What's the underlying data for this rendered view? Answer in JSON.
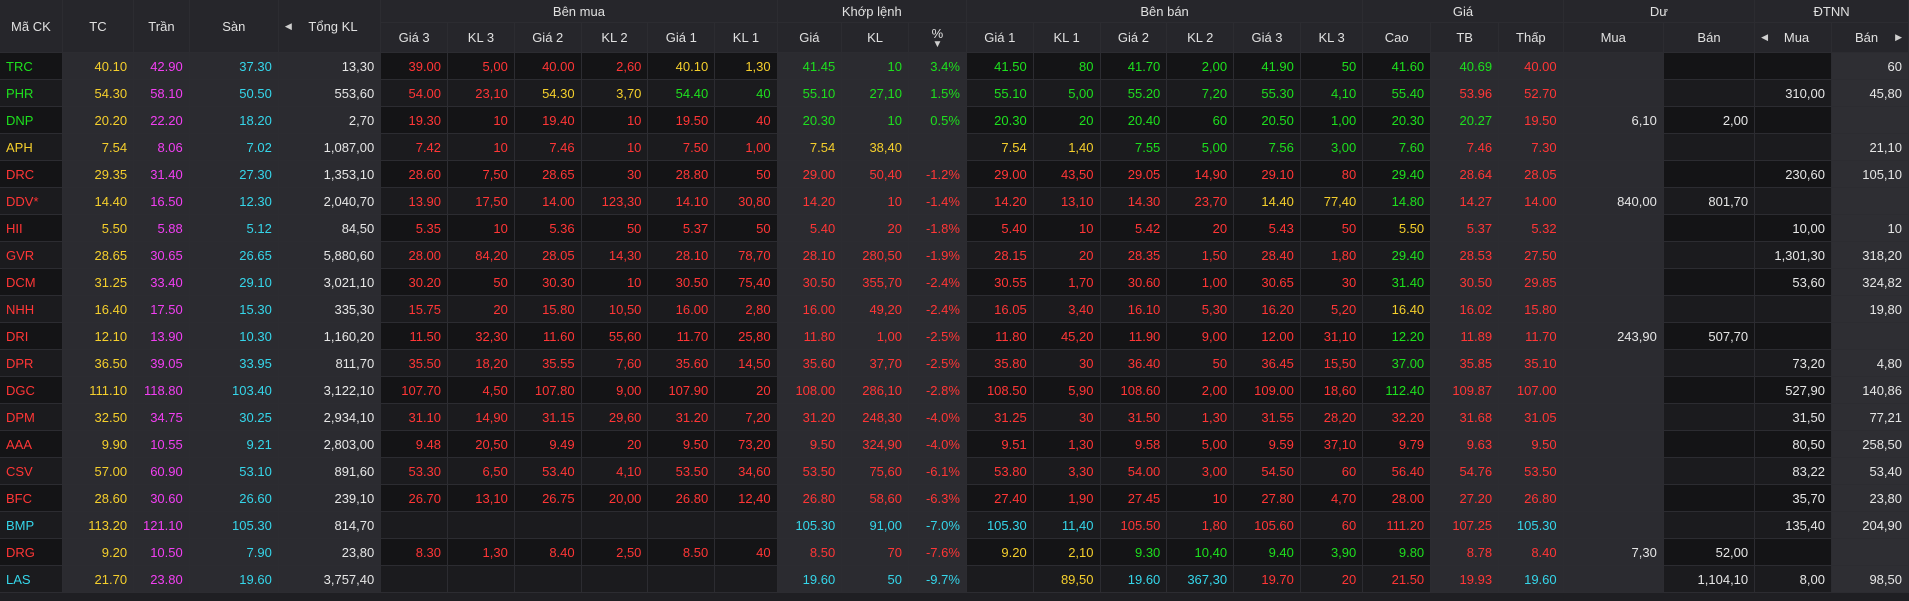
{
  "colors": {
    "up": "#1ee01e",
    "down": "#ff3636",
    "ref": "#f5cf2c",
    "ceiling": "#f23ff2",
    "floor": "#35d6ea"
  },
  "headers": {
    "symbol": "Mã CK",
    "ref": "TC",
    "ceil": "Trần",
    "floor": "Sàn",
    "total_vol": "Tổng KL",
    "bid_group": "Bên mua",
    "match_group": "Khớp lệnh",
    "ask_group": "Bên bán",
    "price_group": "Giá",
    "remain_group": "Dư",
    "foreign_group": "ĐTNN",
    "bid": [
      "Giá 3",
      "KL 3",
      "Giá 2",
      "KL 2",
      "Giá 1",
      "KL 1"
    ],
    "match": [
      "Giá",
      "KL",
      "%"
    ],
    "ask": [
      "Giá 1",
      "KL 1",
      "Giá 2",
      "KL 2",
      "Giá 3",
      "KL 3"
    ],
    "price": [
      "Cao",
      "TB",
      "Thấp"
    ],
    "remain": [
      "Mua",
      "Bán"
    ],
    "foreign": [
      "Mua",
      "Bán"
    ],
    "left_arrow": "◀",
    "right_arrow": "▶",
    "sort_arrow": "▼"
  },
  "rows": [
    {
      "s": "TRC",
      "c": "up",
      "v": [
        "40.10",
        "42.90",
        "37.30",
        "13,30",
        "39.00",
        "5,00",
        "40.00",
        "2,60",
        "40.10",
        "1,30",
        "41.45",
        "10",
        "3.4%",
        "41.50",
        "80",
        "41.70",
        "2,00",
        "41.90",
        "50",
        "41.60",
        "40.69",
        "40.00",
        "",
        "",
        "",
        "60"
      ],
      "k": [
        "ref",
        "ceil",
        "floor",
        "neu",
        "down",
        "down",
        "down",
        "down",
        "ref",
        "ref",
        "up",
        "up",
        "up",
        "up",
        "up",
        "up",
        "up",
        "up",
        "up",
        "up",
        "up",
        "down",
        "neu",
        "neu",
        "neu",
        "neu"
      ]
    },
    {
      "s": "PHR",
      "c": "up",
      "v": [
        "54.30",
        "58.10",
        "50.50",
        "553,60",
        "54.00",
        "23,10",
        "54.30",
        "3,70",
        "54.40",
        "40",
        "55.10",
        "27,10",
        "1.5%",
        "55.10",
        "5,00",
        "55.20",
        "7,20",
        "55.30",
        "4,10",
        "55.40",
        "53.96",
        "52.70",
        "",
        "",
        "310,00",
        "45,80"
      ],
      "k": [
        "ref",
        "ceil",
        "floor",
        "neu",
        "down",
        "down",
        "ref",
        "ref",
        "up",
        "up",
        "up",
        "up",
        "up",
        "up",
        "up",
        "up",
        "up",
        "up",
        "up",
        "up",
        "down",
        "down",
        "neu",
        "neu",
        "neu",
        "neu"
      ]
    },
    {
      "s": "DNP",
      "c": "up",
      "v": [
        "20.20",
        "22.20",
        "18.20",
        "2,70",
        "19.30",
        "10",
        "19.40",
        "10",
        "19.50",
        "40",
        "20.30",
        "10",
        "0.5%",
        "20.30",
        "20",
        "20.40",
        "60",
        "20.50",
        "1,00",
        "20.30",
        "20.27",
        "19.50",
        "6,10",
        "2,00",
        "",
        ""
      ],
      "k": [
        "ref",
        "ceil",
        "floor",
        "neu",
        "down",
        "down",
        "down",
        "down",
        "down",
        "down",
        "up",
        "up",
        "up",
        "up",
        "up",
        "up",
        "up",
        "up",
        "up",
        "up",
        "up",
        "down",
        "neu",
        "neu",
        "neu",
        "neu"
      ]
    },
    {
      "s": "APH",
      "c": "ref",
      "v": [
        "7.54",
        "8.06",
        "7.02",
        "1,087,00",
        "7.42",
        "10",
        "7.46",
        "10",
        "7.50",
        "1,00",
        "7.54",
        "38,40",
        "",
        "7.54",
        "1,40",
        "7.55",
        "5,00",
        "7.56",
        "3,00",
        "7.60",
        "7.46",
        "7.30",
        "",
        "",
        "",
        "21,10"
      ],
      "k": [
        "ref",
        "ceil",
        "floor",
        "neu",
        "down",
        "down",
        "down",
        "down",
        "down",
        "down",
        "ref",
        "ref",
        "ref",
        "ref",
        "ref",
        "up",
        "up",
        "up",
        "up",
        "up",
        "down",
        "down",
        "neu",
        "neu",
        "neu",
        "neu"
      ]
    },
    {
      "s": "DRC",
      "c": "down",
      "v": [
        "29.35",
        "31.40",
        "27.30",
        "1,353,10",
        "28.60",
        "7,50",
        "28.65",
        "30",
        "28.80",
        "50",
        "29.00",
        "50,40",
        "-1.2%",
        "29.00",
        "43,50",
        "29.05",
        "14,90",
        "29.10",
        "80",
        "29.40",
        "28.64",
        "28.05",
        "",
        "",
        "230,60",
        "105,10"
      ],
      "k": [
        "ref",
        "ceil",
        "floor",
        "neu",
        "down",
        "down",
        "down",
        "down",
        "down",
        "down",
        "down",
        "down",
        "down",
        "down",
        "down",
        "down",
        "down",
        "down",
        "down",
        "up",
        "down",
        "down",
        "neu",
        "neu",
        "neu",
        "neu"
      ]
    },
    {
      "s": "DDV*",
      "c": "down",
      "v": [
        "14.40",
        "16.50",
        "12.30",
        "2,040,70",
        "13.90",
        "17,50",
        "14.00",
        "123,30",
        "14.10",
        "30,80",
        "14.20",
        "10",
        "-1.4%",
        "14.20",
        "13,10",
        "14.30",
        "23,70",
        "14.40",
        "77,40",
        "14.80",
        "14.27",
        "14.00",
        "840,00",
        "801,70",
        "",
        ""
      ],
      "k": [
        "ref",
        "ceil",
        "floor",
        "neu",
        "down",
        "down",
        "down",
        "down",
        "down",
        "down",
        "down",
        "down",
        "down",
        "down",
        "down",
        "down",
        "down",
        "ref",
        "ref",
        "up",
        "down",
        "down",
        "neu",
        "neu",
        "neu",
        "neu"
      ]
    },
    {
      "s": "HII",
      "c": "down",
      "v": [
        "5.50",
        "5.88",
        "5.12",
        "84,50",
        "5.35",
        "10",
        "5.36",
        "50",
        "5.37",
        "50",
        "5.40",
        "20",
        "-1.8%",
        "5.40",
        "10",
        "5.42",
        "20",
        "5.43",
        "50",
        "5.50",
        "5.37",
        "5.32",
        "",
        "",
        "10,00",
        "10"
      ],
      "k": [
        "ref",
        "ceil",
        "floor",
        "neu",
        "down",
        "down",
        "down",
        "down",
        "down",
        "down",
        "down",
        "down",
        "down",
        "down",
        "down",
        "down",
        "down",
        "down",
        "down",
        "ref",
        "down",
        "down",
        "neu",
        "neu",
        "neu",
        "neu"
      ]
    },
    {
      "s": "GVR",
      "c": "down",
      "v": [
        "28.65",
        "30.65",
        "26.65",
        "5,880,60",
        "28.00",
        "84,20",
        "28.05",
        "14,30",
        "28.10",
        "78,70",
        "28.10",
        "280,50",
        "-1.9%",
        "28.15",
        "20",
        "28.35",
        "1,50",
        "28.40",
        "1,80",
        "29.40",
        "28.53",
        "27.50",
        "",
        "",
        "1,301,30",
        "318,20"
      ],
      "k": [
        "ref",
        "ceil",
        "floor",
        "neu",
        "down",
        "down",
        "down",
        "down",
        "down",
        "down",
        "down",
        "down",
        "down",
        "down",
        "down",
        "down",
        "down",
        "down",
        "down",
        "up",
        "down",
        "down",
        "neu",
        "neu",
        "neu",
        "neu"
      ]
    },
    {
      "s": "DCM",
      "c": "down",
      "v": [
        "31.25",
        "33.40",
        "29.10",
        "3,021,10",
        "30.20",
        "50",
        "30.30",
        "10",
        "30.50",
        "75,40",
        "30.50",
        "355,70",
        "-2.4%",
        "30.55",
        "1,70",
        "30.60",
        "1,00",
        "30.65",
        "30",
        "31.40",
        "30.50",
        "29.85",
        "",
        "",
        "53,60",
        "324,82"
      ],
      "k": [
        "ref",
        "ceil",
        "floor",
        "neu",
        "down",
        "down",
        "down",
        "down",
        "down",
        "down",
        "down",
        "down",
        "down",
        "down",
        "down",
        "down",
        "down",
        "down",
        "down",
        "up",
        "down",
        "down",
        "neu",
        "neu",
        "neu",
        "neu"
      ]
    },
    {
      "s": "NHH",
      "c": "down",
      "v": [
        "16.40",
        "17.50",
        "15.30",
        "335,30",
        "15.75",
        "20",
        "15.80",
        "10,50",
        "16.00",
        "2,80",
        "16.00",
        "49,20",
        "-2.4%",
        "16.05",
        "3,40",
        "16.10",
        "5,30",
        "16.20",
        "5,20",
        "16.40",
        "16.02",
        "15.80",
        "",
        "",
        "",
        "19,80"
      ],
      "k": [
        "ref",
        "ceil",
        "floor",
        "neu",
        "down",
        "down",
        "down",
        "down",
        "down",
        "down",
        "down",
        "down",
        "down",
        "down",
        "down",
        "down",
        "down",
        "down",
        "down",
        "ref",
        "down",
        "down",
        "neu",
        "neu",
        "neu",
        "neu"
      ]
    },
    {
      "s": "DRI",
      "c": "down",
      "v": [
        "12.10",
        "13.90",
        "10.30",
        "1,160,20",
        "11.50",
        "32,30",
        "11.60",
        "55,60",
        "11.70",
        "25,80",
        "11.80",
        "1,00",
        "-2.5%",
        "11.80",
        "45,20",
        "11.90",
        "9,00",
        "12.00",
        "31,10",
        "12.20",
        "11.89",
        "11.70",
        "243,90",
        "507,70",
        "",
        ""
      ],
      "k": [
        "ref",
        "ceil",
        "floor",
        "neu",
        "down",
        "down",
        "down",
        "down",
        "down",
        "down",
        "down",
        "down",
        "down",
        "down",
        "down",
        "down",
        "down",
        "down",
        "down",
        "up",
        "down",
        "down",
        "neu",
        "neu",
        "neu",
        "neu"
      ]
    },
    {
      "s": "DPR",
      "c": "down",
      "v": [
        "36.50",
        "39.05",
        "33.95",
        "811,70",
        "35.50",
        "18,20",
        "35.55",
        "7,60",
        "35.60",
        "14,50",
        "35.60",
        "37,70",
        "-2.5%",
        "35.80",
        "30",
        "36.40",
        "50",
        "36.45",
        "15,50",
        "37.00",
        "35.85",
        "35.10",
        "",
        "",
        "73,20",
        "4,80"
      ],
      "k": [
        "ref",
        "ceil",
        "floor",
        "neu",
        "down",
        "down",
        "down",
        "down",
        "down",
        "down",
        "down",
        "down",
        "down",
        "down",
        "down",
        "down",
        "down",
        "down",
        "down",
        "up",
        "down",
        "down",
        "neu",
        "neu",
        "neu",
        "neu"
      ]
    },
    {
      "s": "DGC",
      "c": "down",
      "v": [
        "111.10",
        "118.80",
        "103.40",
        "3,122,10",
        "107.70",
        "4,50",
        "107.80",
        "9,00",
        "107.90",
        "20",
        "108.00",
        "286,10",
        "-2.8%",
        "108.50",
        "5,90",
        "108.60",
        "2,00",
        "109.00",
        "18,60",
        "112.40",
        "109.87",
        "107.00",
        "",
        "",
        "527,90",
        "140,86"
      ],
      "k": [
        "ref",
        "ceil",
        "floor",
        "neu",
        "down",
        "down",
        "down",
        "down",
        "down",
        "down",
        "down",
        "down",
        "down",
        "down",
        "down",
        "down",
        "down",
        "down",
        "down",
        "up",
        "down",
        "down",
        "neu",
        "neu",
        "neu",
        "neu"
      ]
    },
    {
      "s": "DPM",
      "c": "down",
      "v": [
        "32.50",
        "34.75",
        "30.25",
        "2,934,10",
        "31.10",
        "14,90",
        "31.15",
        "29,60",
        "31.20",
        "7,20",
        "31.20",
        "248,30",
        "-4.0%",
        "31.25",
        "30",
        "31.50",
        "1,30",
        "31.55",
        "28,20",
        "32.20",
        "31.68",
        "31.05",
        "",
        "",
        "31,50",
        "77,21"
      ],
      "k": [
        "ref",
        "ceil",
        "floor",
        "neu",
        "down",
        "down",
        "down",
        "down",
        "down",
        "down",
        "down",
        "down",
        "down",
        "down",
        "down",
        "down",
        "down",
        "down",
        "down",
        "down",
        "down",
        "down",
        "neu",
        "neu",
        "neu",
        "neu"
      ]
    },
    {
      "s": "AAA",
      "c": "down",
      "v": [
        "9.90",
        "10.55",
        "9.21",
        "2,803,00",
        "9.48",
        "20,50",
        "9.49",
        "20",
        "9.50",
        "73,20",
        "9.50",
        "324,90",
        "-4.0%",
        "9.51",
        "1,30",
        "9.58",
        "5,00",
        "9.59",
        "37,10",
        "9.79",
        "9.63",
        "9.50",
        "",
        "",
        "80,50",
        "258,50"
      ],
      "k": [
        "ref",
        "ceil",
        "floor",
        "neu",
        "down",
        "down",
        "down",
        "down",
        "down",
        "down",
        "down",
        "down",
        "down",
        "down",
        "down",
        "down",
        "down",
        "down",
        "down",
        "down",
        "down",
        "down",
        "neu",
        "neu",
        "neu",
        "neu"
      ]
    },
    {
      "s": "CSV",
      "c": "down",
      "v": [
        "57.00",
        "60.90",
        "53.10",
        "891,60",
        "53.30",
        "6,50",
        "53.40",
        "4,10",
        "53.50",
        "34,60",
        "53.50",
        "75,60",
        "-6.1%",
        "53.80",
        "3,30",
        "54.00",
        "3,00",
        "54.50",
        "60",
        "56.40",
        "54.76",
        "53.50",
        "",
        "",
        "83,22",
        "53,40"
      ],
      "k": [
        "ref",
        "ceil",
        "floor",
        "neu",
        "down",
        "down",
        "down",
        "down",
        "down",
        "down",
        "down",
        "down",
        "down",
        "down",
        "down",
        "down",
        "down",
        "down",
        "down",
        "down",
        "down",
        "down",
        "neu",
        "neu",
        "neu",
        "neu"
      ]
    },
    {
      "s": "BFC",
      "c": "down",
      "v": [
        "28.60",
        "30.60",
        "26.60",
        "239,10",
        "26.70",
        "13,10",
        "26.75",
        "20,00",
        "26.80",
        "12,40",
        "26.80",
        "58,60",
        "-6.3%",
        "27.40",
        "1,90",
        "27.45",
        "10",
        "27.80",
        "4,70",
        "28.00",
        "27.20",
        "26.80",
        "",
        "",
        "35,70",
        "23,80"
      ],
      "k": [
        "ref",
        "ceil",
        "floor",
        "neu",
        "down",
        "down",
        "down",
        "down",
        "down",
        "down",
        "down",
        "down",
        "down",
        "down",
        "down",
        "down",
        "down",
        "down",
        "down",
        "down",
        "down",
        "down",
        "neu",
        "neu",
        "neu",
        "neu"
      ]
    },
    {
      "s": "BMP",
      "c": "floor",
      "v": [
        "113.20",
        "121.10",
        "105.30",
        "814,70",
        "",
        "",
        "",
        "",
        "",
        "",
        "105.30",
        "91,00",
        "-7.0%",
        "105.30",
        "11,40",
        "105.50",
        "1,80",
        "105.60",
        "60",
        "111.20",
        "107.25",
        "105.30",
        "",
        "",
        "135,40",
        "204,90"
      ],
      "k": [
        "ref",
        "ceil",
        "floor",
        "neu",
        "down",
        "down",
        "down",
        "down",
        "down",
        "down",
        "floor",
        "floor",
        "floor",
        "floor",
        "floor",
        "down",
        "down",
        "down",
        "down",
        "down",
        "down",
        "floor",
        "neu",
        "neu",
        "neu",
        "neu"
      ]
    },
    {
      "s": "DRG",
      "c": "down",
      "v": [
        "9.20",
        "10.50",
        "7.90",
        "23,80",
        "8.30",
        "1,30",
        "8.40",
        "2,50",
        "8.50",
        "40",
        "8.50",
        "70",
        "-7.6%",
        "9.20",
        "2,10",
        "9.30",
        "10,40",
        "9.40",
        "3,90",
        "9.80",
        "8.78",
        "8.40",
        "7,30",
        "52,00",
        "",
        ""
      ],
      "k": [
        "ref",
        "ceil",
        "floor",
        "neu",
        "down",
        "down",
        "down",
        "down",
        "down",
        "down",
        "down",
        "down",
        "down",
        "ref",
        "ref",
        "up",
        "up",
        "up",
        "up",
        "up",
        "down",
        "down",
        "neu",
        "neu",
        "neu",
        "neu"
      ]
    },
    {
      "s": "LAS",
      "c": "floor",
      "v": [
        "21.70",
        "23.80",
        "19.60",
        "3,757,40",
        "",
        "",
        "",
        "",
        "",
        "",
        "19.60",
        "50",
        "-9.7%",
        "",
        "89,50",
        "19.60",
        "367,30",
        "19.70",
        "20",
        "21.50",
        "19.93",
        "19.60",
        "",
        "1,104,10",
        "8,00",
        "98,50"
      ],
      "k": [
        "ref",
        "ceil",
        "floor",
        "neu",
        "down",
        "down",
        "down",
        "down",
        "down",
        "down",
        "floor",
        "floor",
        "floor",
        "floor",
        "ref",
        "floor",
        "floor",
        "down",
        "down",
        "down",
        "down",
        "floor",
        "neu",
        "neu",
        "neu",
        "neu"
      ]
    }
  ]
}
